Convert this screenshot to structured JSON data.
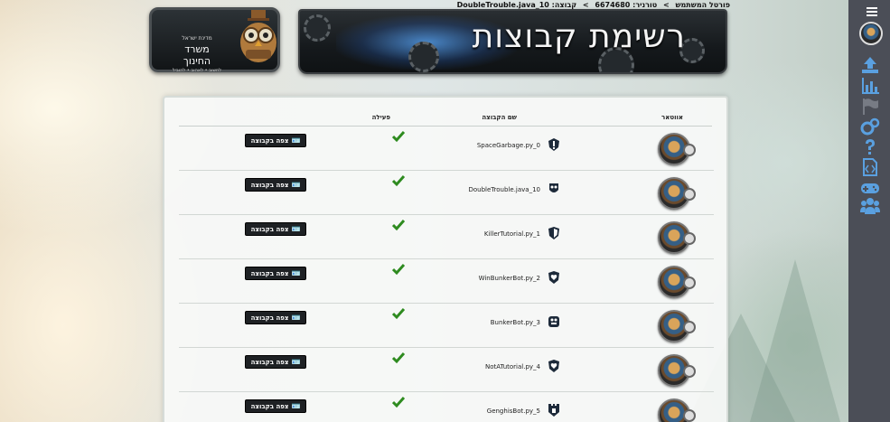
{
  "breadcrumb": {
    "portal": "פורטל המשתמש",
    "sep1": ">",
    "tournament": "טורניר: 6674680",
    "sep2": ">",
    "group_label": "קבוצה: DoubleTrouble.java_10"
  },
  "banner": {
    "title": "רשימת קבוצות"
  },
  "logo": {
    "top": "מדינת ישראל",
    "main": "משרד החינוך",
    "sub": "לחשוב • לאהוב • להוביל"
  },
  "table": {
    "headers": {
      "avatar": "אווטאר",
      "name": "שם הקבוצה",
      "active": "פעילה"
    },
    "rows": [
      {
        "name": "SpaceGarbage.py_0",
        "icon": "exclamation-shield-icon",
        "button": "צפה בקבוצה"
      },
      {
        "name": "DoubleTrouble.java_10",
        "icon": "mask-icon",
        "button": "צפה בקבוצה"
      },
      {
        "name": "KillerTutorial.py_1",
        "icon": "half-shield-icon",
        "button": "צפה בקבוצה"
      },
      {
        "name": "WinBunkerBot.py_2",
        "icon": "heart-shield-icon",
        "button": "צפה בקבוצה"
      },
      {
        "name": "BunkerBot.py_3",
        "icon": "badge-icon",
        "button": "צפה בקבוצה"
      },
      {
        "name": "NotATutorial.py_4",
        "icon": "heart-shield-icon",
        "button": "צפה בקבוצה"
      },
      {
        "name": "GenghisBot.py_5",
        "icon": "tower-shield-icon",
        "button": "צפה בקבוצה"
      }
    ]
  },
  "colors": {
    "sidebar": "#4b4e57",
    "icon_blue": "#5aa0e0",
    "check_green": "#2e8b1f",
    "button_bg": "#1e2124"
  }
}
